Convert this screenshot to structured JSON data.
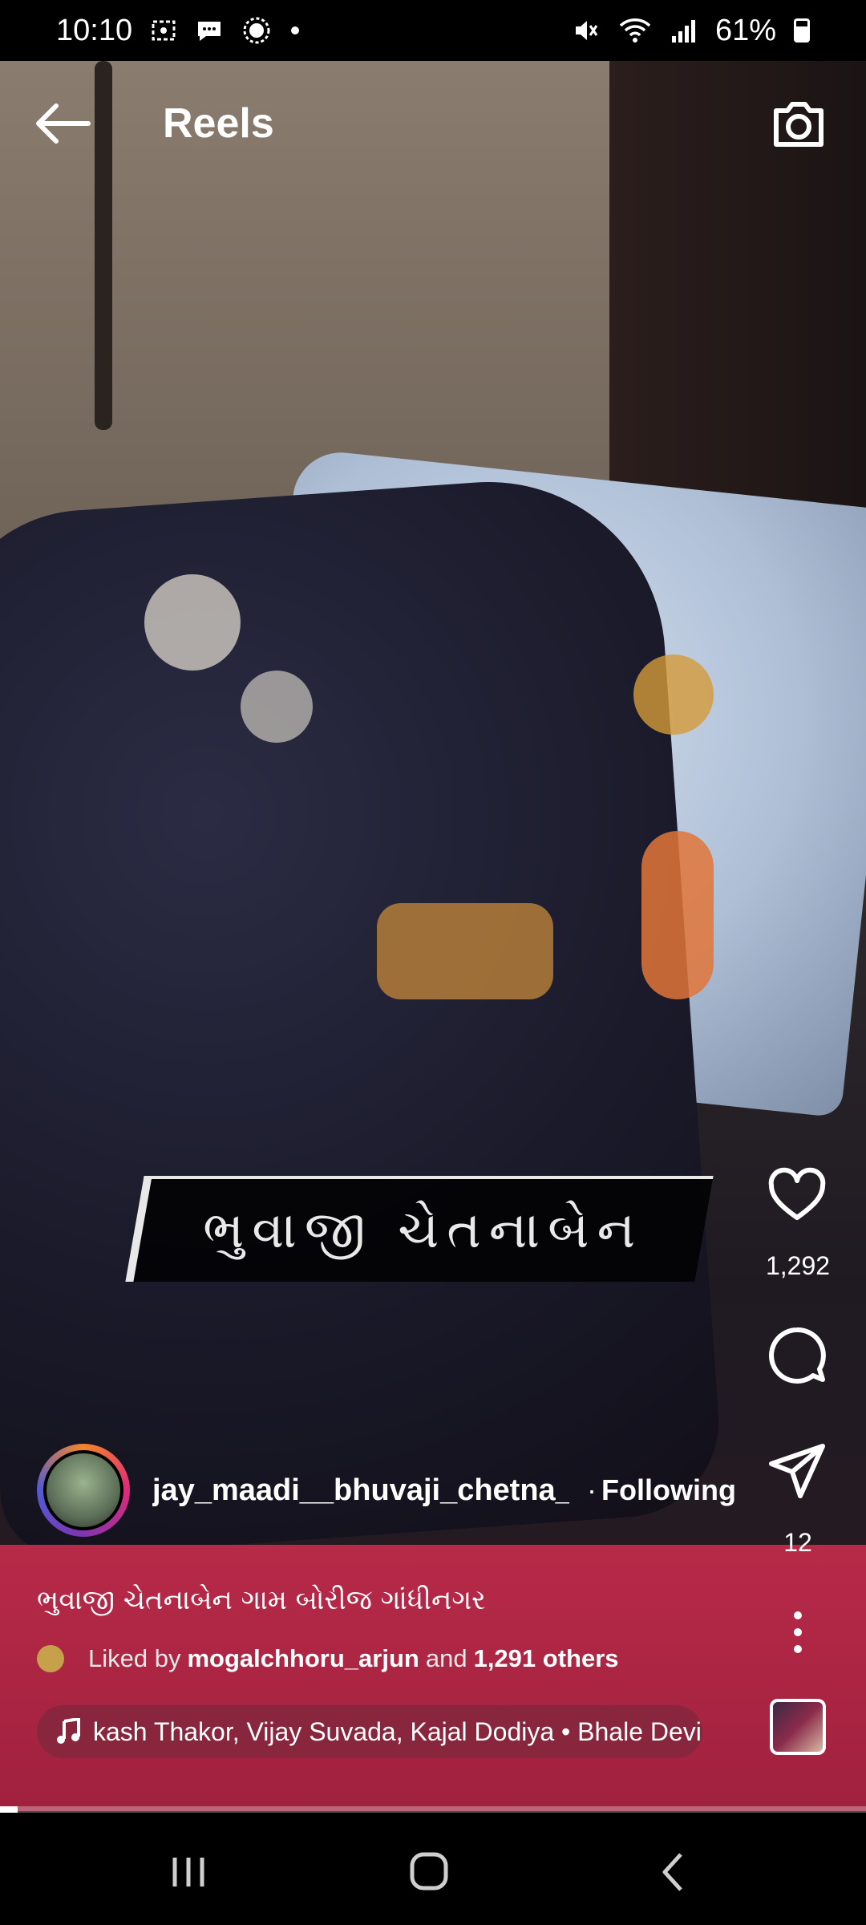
{
  "status_bar": {
    "time": "10:10",
    "battery": "61%",
    "icons_left": [
      "screen-record-icon",
      "message-icon",
      "brightness-icon",
      "dot-icon"
    ],
    "icons_right": [
      "mute-icon",
      "wifi-icon",
      "signal-icon",
      "battery-icon"
    ]
  },
  "header": {
    "title": "Reels",
    "back_icon": "arrow-left-icon",
    "camera_icon": "camera-icon"
  },
  "video": {
    "overlay_text": "ભુવાજી ચેતનાબેન"
  },
  "actions": {
    "likes": "1,292",
    "shares": "12"
  },
  "post": {
    "username": "jay_maadi__bhuvaji_chetna_...",
    "separator": "·",
    "follow_label": "Following",
    "caption": "ભુવાજી ચેતનાબેન ગામ બોરીજ ગાંધીનગર",
    "liked_by_prefix": "Liked by",
    "liked_by_user": "mogalchhoru_arjun",
    "liked_by_and": "and",
    "liked_by_others": "1,291 others",
    "audio": "kash Thakor, Vijay Suvada, Kajal Dodiya • Bhale Devi"
  },
  "playback": {
    "progress": 0.02
  },
  "colors": {
    "background": "#000000",
    "text": "#ffffff",
    "mat": "#b72a48"
  }
}
